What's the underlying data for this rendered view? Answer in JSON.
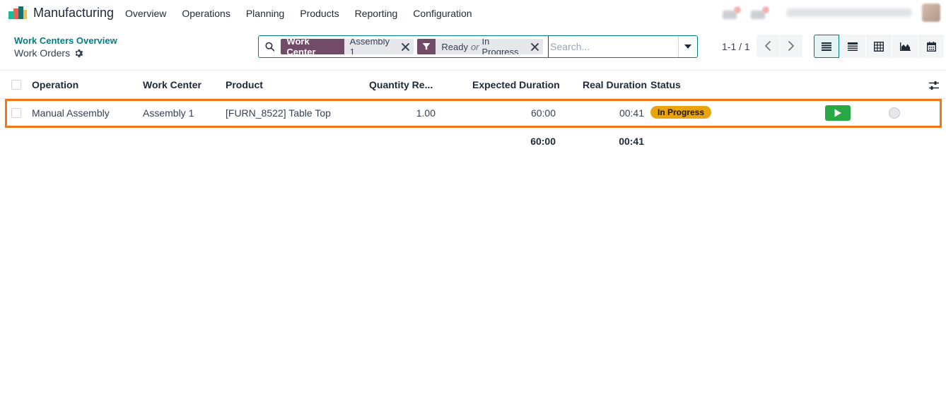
{
  "app": {
    "name": "Manufacturing",
    "logo_colors": [
      "#21b799",
      "#f06050",
      "#1a6f6f",
      "#fbb945"
    ]
  },
  "menu": [
    "Overview",
    "Operations",
    "Planning",
    "Products",
    "Reporting",
    "Configuration"
  ],
  "breadcrumb": {
    "parent": "Work Centers Overview",
    "current": "Work Orders"
  },
  "search": {
    "facets": [
      {
        "label": "Work Center",
        "values": [
          "Assembly 1"
        ]
      },
      {
        "label_icon": "filter-icon",
        "values": [
          "Ready",
          "In Progress"
        ],
        "separator": "or"
      }
    ],
    "placeholder": "Search..."
  },
  "pager": {
    "value": "1-1 / 1"
  },
  "views": [
    "list-view-icon",
    "kanban-view-icon",
    "pivot-view-icon",
    "graph-view-icon",
    "calendar-view-icon"
  ],
  "table": {
    "columns": [
      "Operation",
      "Work Center",
      "Product",
      "Quantity Re...",
      "Expected Duration",
      "Real Duration",
      "Status"
    ],
    "rows": [
      {
        "operation": "Manual Assembly",
        "work_center": "Assembly 1",
        "product": "[FURN_8522] Table Top",
        "quantity": "1.00",
        "expected_duration": "60:00",
        "real_duration": "00:41",
        "status": "In Progress"
      }
    ],
    "totals": {
      "expected_duration": "60:00",
      "real_duration": "00:41"
    }
  },
  "colors": {
    "accent": "#017e84",
    "brand": "#714b67",
    "highlight": "#f07616",
    "status_in_progress": "#e9a30b",
    "play": "#28a745"
  }
}
